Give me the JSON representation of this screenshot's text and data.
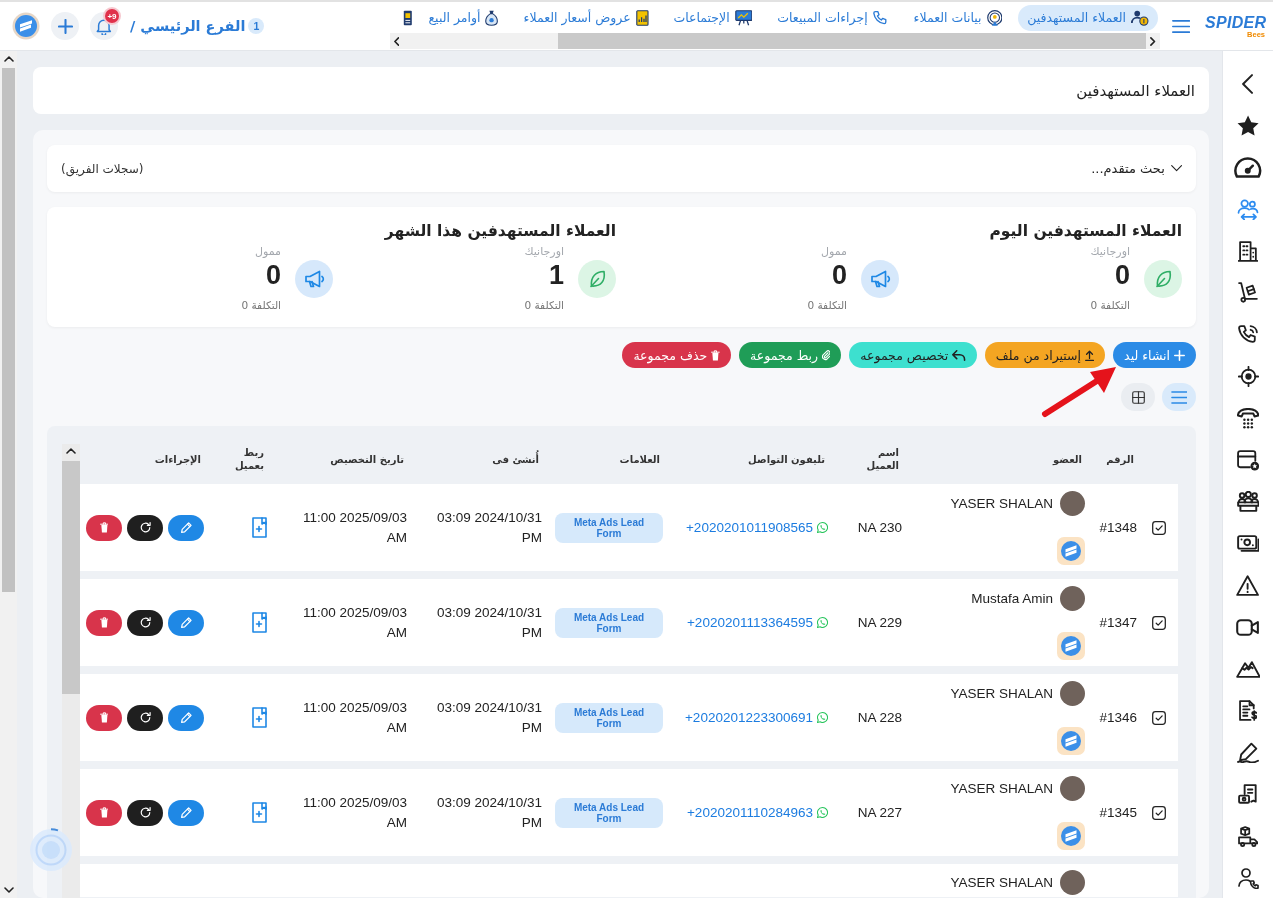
{
  "topbar": {
    "logo": {
      "name": "SPIDER",
      "tagline": "Bees"
    },
    "tabs": [
      {
        "label": "العملاء المستهدفين",
        "selected": true
      },
      {
        "label": "بيانات العملاء",
        "selected": false
      },
      {
        "label": "إجراءات المبيعات",
        "selected": false
      },
      {
        "label": "الإجتماعات",
        "selected": false
      },
      {
        "label": "عروض أسعار العملاء",
        "selected": false
      },
      {
        "label": "أوامر البيع",
        "selected": false
      },
      {
        "selected": false
      }
    ],
    "branch": {
      "count": "1",
      "name": "الفرع الرئيسي /"
    },
    "notifications": {
      "badge": "+9"
    }
  },
  "page_title": "العملاء المستهدفين",
  "search": {
    "label": "بحث متقدم...",
    "expanded": false,
    "scope": "(سجلات الفريق)"
  },
  "stats": [
    {
      "title": "العملاء المستهدفين اليوم",
      "items": [
        {
          "kind": "organic",
          "label": "اورجانيك",
          "value": "0",
          "cost": "التكلفة 0"
        },
        {
          "kind": "paid",
          "label": "ممول",
          "value": "0",
          "cost": "التكلفة 0"
        }
      ]
    },
    {
      "title": "العملاء المستهدفين هذا الشهر",
      "items": [
        {
          "kind": "organic",
          "label": "اورجانيك",
          "value": "1",
          "cost": "التكلفة 0"
        },
        {
          "kind": "paid",
          "label": "ممول",
          "value": "0",
          "cost": "التكلفة 0"
        }
      ]
    }
  ],
  "actions": [
    {
      "kind": "create",
      "label": "انشاء ليد"
    },
    {
      "kind": "import",
      "label": "إستيراد من ملف"
    },
    {
      "kind": "assign",
      "label": "تخصيص مجموعه"
    },
    {
      "kind": "link",
      "label": "ربط مجموعة"
    },
    {
      "kind": "delete",
      "label": "حذف مجموعة"
    }
  ],
  "annotation": {
    "kind": "arrow"
  },
  "views": [
    {
      "kind": "list",
      "selected": true
    },
    {
      "kind": "grid",
      "selected": false
    }
  ],
  "table": {
    "columns": [
      "الرقم",
      "العضو",
      "اسم العميل",
      "تليفون التواصل",
      "العلامات",
      "أُنشئ فى",
      "تاريخ التخصيص",
      "ربط بعميل",
      "الإجراءات"
    ],
    "rows": [
      {
        "id": "#1348",
        "member": "YASER SHALAN",
        "client": "NA 230",
        "phone": "+2020201011908565",
        "tags": [
          "Meta Ads Lead Form"
        ],
        "created": "03:09 2024/10/31 PM",
        "assigned": "11:00 2025/09/03 AM"
      },
      {
        "id": "#1347",
        "member": "Mustafa Amin",
        "client": "NA 229",
        "phone": "+2020201113364595",
        "tags": [
          "Meta Ads Lead Form"
        ],
        "created": "03:09 2024/10/31 PM",
        "assigned": "11:00 2025/09/03 AM"
      },
      {
        "id": "#1346",
        "member": "YASER SHALAN",
        "client": "NA 228",
        "phone": "+2020201223300691",
        "tags": [
          "Meta Ads Lead Form"
        ],
        "created": "03:09 2024/10/31 PM",
        "assigned": "11:00 2025/09/03 AM"
      },
      {
        "id": "#1345",
        "member": "YASER SHALAN",
        "client": "NA 227",
        "phone": "+2020201110284963",
        "tags": [
          "Meta Ads Lead Form"
        ],
        "created": "03:09 2024/10/31 PM",
        "assigned": "11:00 2025/09/03 AM"
      }
    ],
    "cut_row": {
      "member": "YASER SHALAN"
    }
  },
  "sidebar": {
    "items": [
      {
        "selected": false
      },
      {
        "selected": false
      },
      {
        "selected": true
      },
      {
        "selected": false
      },
      {
        "selected": false
      },
      {
        "selected": false
      },
      {
        "selected": false
      },
      {
        "selected": false
      },
      {
        "selected": false
      },
      {
        "selected": false
      },
      {
        "selected": false
      },
      {
        "selected": false
      },
      {
        "selected": false
      },
      {
        "selected": false
      },
      {
        "selected": false
      },
      {
        "selected": false
      },
      {
        "selected": false
      },
      {
        "selected": false
      },
      {
        "selected": false
      }
    ]
  }
}
